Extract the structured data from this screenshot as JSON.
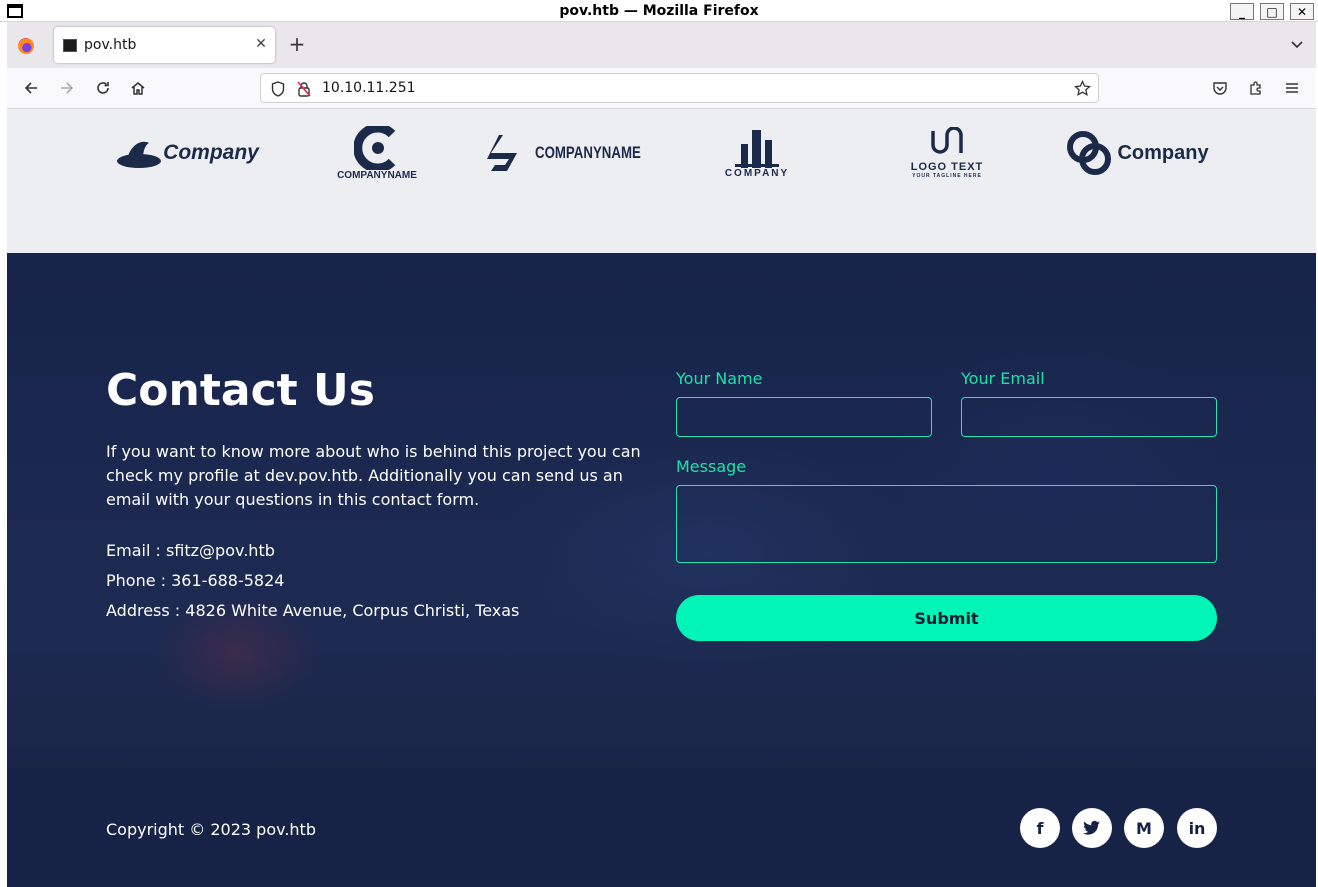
{
  "window": {
    "title": "pov.htb — Mozilla Firefox",
    "minimize_glyph": "_",
    "maximize_glyph": "□",
    "close_glyph": "✕"
  },
  "browser": {
    "tab": {
      "title": "pov.htb",
      "close_glyph": "✕"
    },
    "new_tab_glyph": "+",
    "url": "10.10.11.251"
  },
  "logos": [
    {
      "text": "Company"
    },
    {
      "text": "COMPANYNAME"
    },
    {
      "text": "COMPANYNAME"
    },
    {
      "text": "COMPANY"
    },
    {
      "text": "LOGO TEXT",
      "tagline": "YOUR TAGLINE HERE"
    },
    {
      "text": "Company"
    }
  ],
  "contact": {
    "title": "Contact Us",
    "intro": "If you want to know more about who is behind this project you can check my profile at dev.pov.htb. Additionally you can send us an email with your questions in this contact form.",
    "email": "Email : sfitz@pov.htb",
    "phone": "Phone : 361-688-5824",
    "address": "Address : 4826 White Avenue, Corpus Christi, Texas"
  },
  "form": {
    "name_label": "Your Name",
    "email_label": "Your Email",
    "message_label": "Message",
    "name_value": "",
    "email_value": "",
    "message_value": "",
    "submit_label": "Submit"
  },
  "footer": {
    "copyright": "Copyright © 2023 pov.htb",
    "social": [
      {
        "icon": "facebook-icon",
        "glyph": "f"
      },
      {
        "icon": "twitter-icon",
        "glyph": "t"
      },
      {
        "icon": "medium-icon",
        "glyph": "M"
      },
      {
        "icon": "linkedin-icon",
        "glyph": "in"
      }
    ]
  },
  "colors": {
    "accent": "#00f5b6",
    "label_green": "#1fe2a8",
    "navy": "#172346",
    "logo_navy": "#1c2a4a"
  }
}
